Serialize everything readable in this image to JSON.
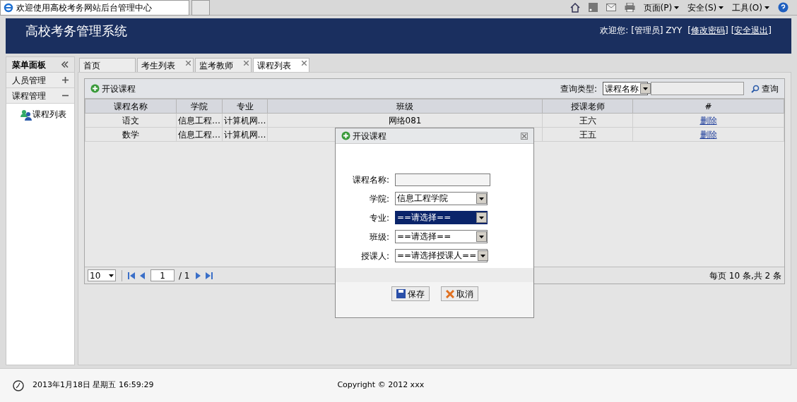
{
  "browser": {
    "tab_title": "欢迎使用高校考务网站后台管理中心",
    "menus": [
      "页面(P)",
      "安全(S)",
      "工具(O)"
    ]
  },
  "header": {
    "title": "高校考务管理系统",
    "welcome": "欢迎您:",
    "user": "[管理员] ZYY",
    "links": [
      "[修改密码]",
      "[安全退出]"
    ]
  },
  "sidebar": {
    "title": "菜单面板",
    "sections": [
      {
        "label": "人员管理",
        "expanded": false
      },
      {
        "label": "课程管理",
        "expanded": true,
        "children": [
          {
            "label": "课程列表"
          }
        ]
      }
    ]
  },
  "tabs": [
    {
      "label": "首页",
      "closable": false,
      "selected": false
    },
    {
      "label": "考生列表",
      "closable": true,
      "selected": false
    },
    {
      "label": "监考教师",
      "closable": true,
      "selected": false
    },
    {
      "label": "课程列表",
      "closable": true,
      "selected": true
    }
  ],
  "toolbar": {
    "add_button": "开设课程",
    "search_type_label": "查询类型:",
    "search_type": "课程名称",
    "search_button": "查询"
  },
  "table": {
    "columns": [
      "课程名称",
      "学院",
      "专业",
      "班级",
      "授课老师",
      "#"
    ],
    "rows": [
      {
        "cells": [
          "语文",
          "信息工程…",
          "计算机网…",
          "网络081",
          "王六"
        ],
        "action": "删除"
      },
      {
        "cells": [
          "数学",
          "信息工程…",
          "计算机网…",
          "",
          "王五"
        ],
        "action": "删除"
      }
    ]
  },
  "pager": {
    "page_size": "10",
    "page": "1",
    "total_pages": "/ 1",
    "summary": "每页 10 条,共 2 条"
  },
  "dialog": {
    "title": "开设课程",
    "fields": [
      {
        "label": "课程名称:",
        "kind": "text"
      },
      {
        "label": "学院:",
        "kind": "select",
        "value": "信息工程学院",
        "focused": false
      },
      {
        "label": "专业:",
        "kind": "select",
        "value": "==请选择==",
        "focused": true
      },
      {
        "label": "班级:",
        "kind": "select",
        "value": "==请选择==",
        "focused": false
      },
      {
        "label": "授课人:",
        "kind": "select",
        "value": "==请选择授课人==",
        "focused": false
      }
    ],
    "buttons": [
      {
        "label": "保存",
        "kind": "save"
      },
      {
        "label": "取消",
        "kind": "cancel"
      }
    ]
  },
  "footer": {
    "datetime": "2013年1月18日 星期五 16:59:29",
    "copyright": "Copyright © 2012 xxx"
  }
}
